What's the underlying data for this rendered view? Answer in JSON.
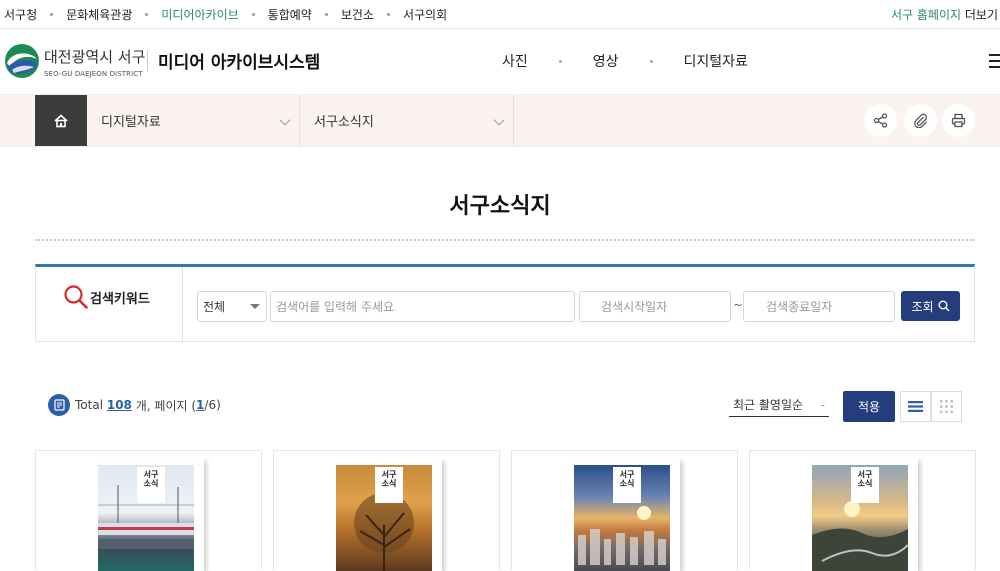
{
  "top_nav": {
    "items": [
      {
        "label": "서구청",
        "active": false
      },
      {
        "label": "문화체육관광",
        "active": false
      },
      {
        "label": "미디어아카이브",
        "active": true
      },
      {
        "label": "통합예약",
        "active": false
      },
      {
        "label": "보건소",
        "active": false
      },
      {
        "label": "서구의회",
        "active": false
      }
    ],
    "homepage_link_green": "서구 홈페이지",
    "homepage_link_more": "더보기"
  },
  "header": {
    "district_kr": "대전광역시 서구",
    "district_en": "SEO-GU DAEJEON DISTRICT",
    "system_name": "미디어 아카이브시스템",
    "menu": [
      "사진",
      "영상",
      "디지털자료"
    ]
  },
  "breadcrumb": {
    "level1": "디지털자료",
    "level2": "서구소식지"
  },
  "page_title": "서구소식지",
  "search": {
    "keyword_label": "검색키워드",
    "category_selected": "전체",
    "keyword_placeholder": "검색어를 입력해 주세요",
    "start_date_placeholder": "검색시작일자",
    "range_sep": "~",
    "end_date_placeholder": "검색종료일자",
    "submit_label": "조회"
  },
  "results": {
    "total_prefix": "Total",
    "total_count": "108",
    "total_suffix": "개, 페이지 (",
    "page_current": "1",
    "page_rest": "/6)",
    "sort_selected": "최근 촬영일순",
    "sort_dash": "-",
    "apply_label": "적용"
  },
  "cards": [
    {
      "cover_title": "서구\n소식"
    },
    {
      "cover_title": "서구\n소식"
    },
    {
      "cover_title": "서구\n소식"
    },
    {
      "cover_title": "서구\n소식"
    }
  ],
  "colors": {
    "accent_green": "#2b8a6b",
    "navy": "#243e7d",
    "blue": "#2e7ab8",
    "subbar_bg": "#fbf3ef"
  }
}
